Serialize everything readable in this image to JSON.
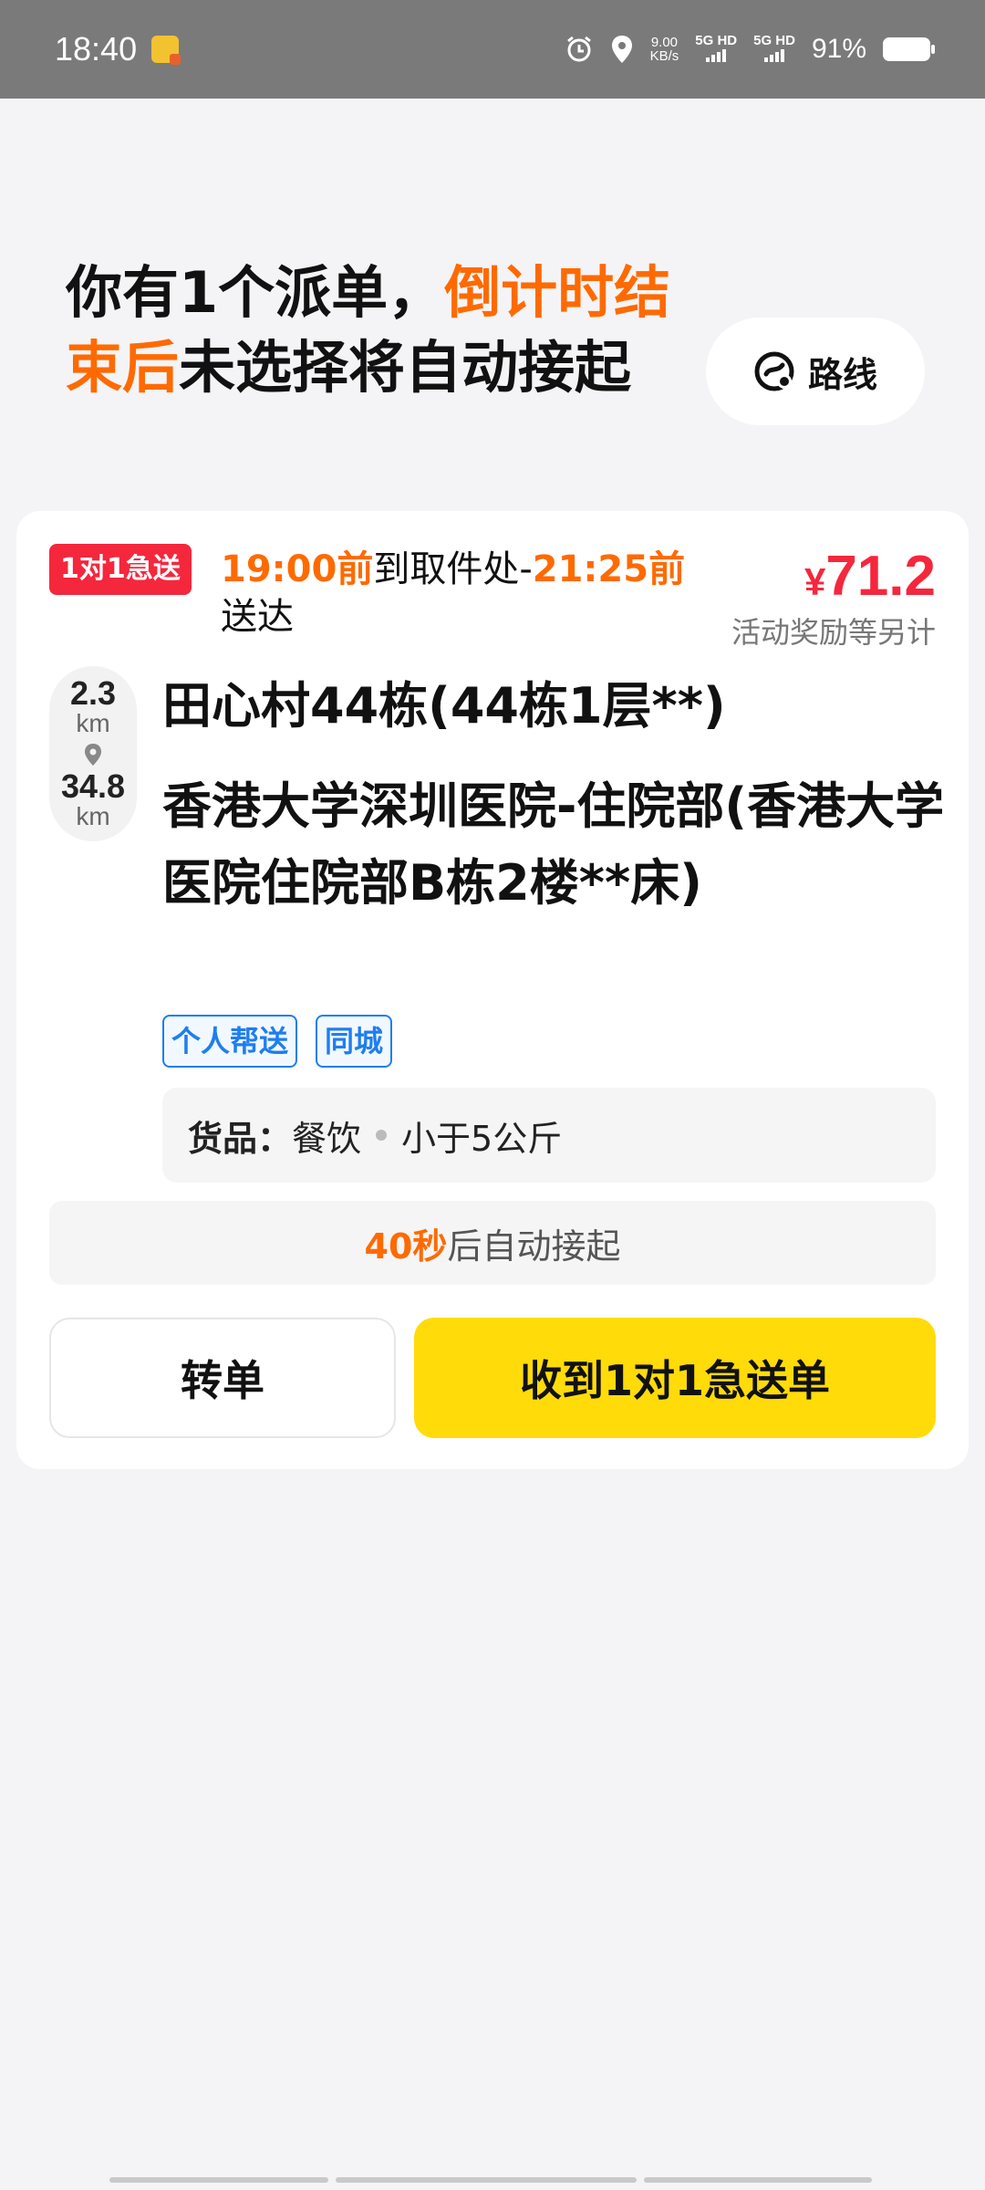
{
  "status_bar": {
    "time": "18:40",
    "speed_value": "9.00",
    "speed_unit": "KB/s",
    "sim1_label": "5G HD",
    "sim2_label": "5G HD",
    "battery": "91%"
  },
  "header": {
    "part1": "你有1个派单，",
    "part2": "倒计时结束后",
    "part3": "未选择将自动接起",
    "route_button": "路线"
  },
  "order": {
    "badge": "1对1急送",
    "pickup_time": "19:00前",
    "to_pickup": "到取件处-",
    "deliver_time": "21:25前",
    "deliver_text": "送达",
    "currency": "¥",
    "price": "71.2",
    "reward_note": "活动奖励等另计",
    "distance_pickup": "2.3",
    "distance_pickup_unit": "km",
    "distance_delivery": "34.8",
    "distance_delivery_unit": "km",
    "pickup_address": "田心村44栋(44栋1层**)",
    "dropoff_address": "香港大学深圳医院-住院部(香港大学医院住院部B栋2楼**床)",
    "tags": [
      "个人帮送",
      "同城"
    ],
    "goods_label": "货品：",
    "goods_type": "餐饮",
    "goods_weight": "小于5公斤",
    "countdown_num": "40秒",
    "countdown_text": "后自动接起",
    "transfer_button": "转单",
    "accept_button": "收到1对1急送单"
  },
  "colors": {
    "accent_orange": "#ff6a00",
    "price_red": "#f5273d",
    "accept_yellow": "#ffdb0a",
    "tag_blue": "#1e7ef0"
  }
}
